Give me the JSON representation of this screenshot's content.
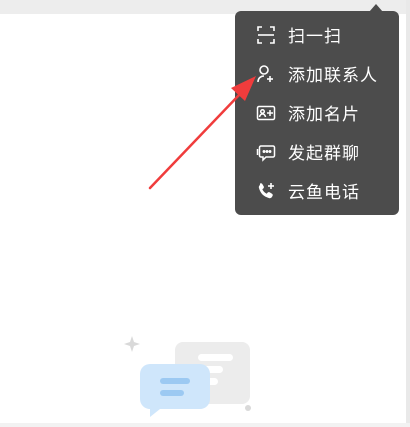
{
  "menu": {
    "items": [
      {
        "label": "扫一扫",
        "icon": "scan-icon"
      },
      {
        "label": "添加联系人",
        "icon": "add-contact-icon"
      },
      {
        "label": "添加名片",
        "icon": "add-card-icon"
      },
      {
        "label": "发起群聊",
        "icon": "group-chat-icon"
      },
      {
        "label": "云鱼电话",
        "icon": "phone-call-icon"
      }
    ]
  },
  "colors": {
    "menu_bg": "#4c4c4c",
    "menu_text": "#ffffff",
    "annotation_arrow": "#f03c3c",
    "page_bg": "#ffffff"
  }
}
